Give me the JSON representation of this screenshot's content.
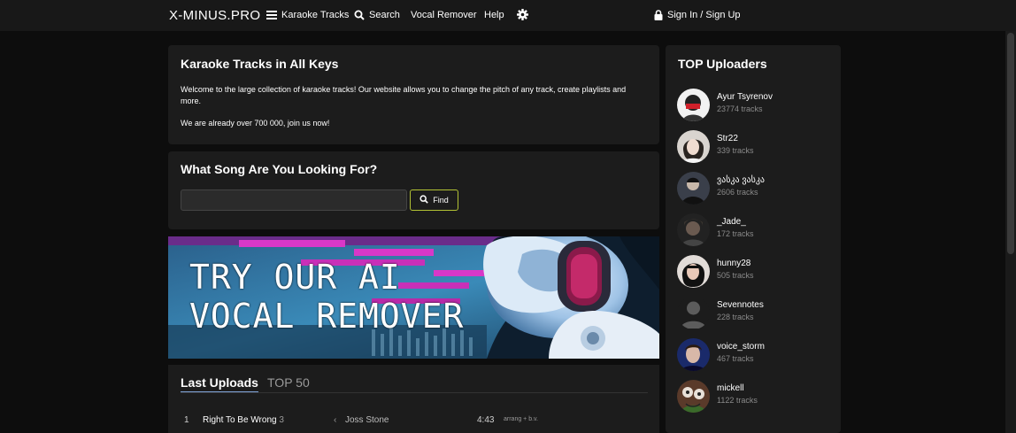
{
  "nav": {
    "logo": "X-MINUS.PRO",
    "karaoke_tracks": "Karaoke Tracks",
    "search": "Search",
    "vocal_remover": "Vocal Remover",
    "help": "Help",
    "sign_in": "Sign In / Sign Up"
  },
  "intro": {
    "title": "Karaoke Tracks in All Keys",
    "paragraph1": "Welcome to the large collection of karaoke tracks! Our website allows you to change the pitch of any track, create playlists and more.",
    "paragraph2": "We are already over 700 000, join us now!"
  },
  "search_box": {
    "title": "What Song Are You Looking For?",
    "input_value": "",
    "placeholder": "",
    "find_label": "Find"
  },
  "banner": {
    "line1": "TRY OUR AI",
    "line2": "VOCAL REMOVER"
  },
  "tabs": {
    "last_uploads": "Last Uploads",
    "top50": "TOP 50"
  },
  "uploads": [
    {
      "num": "1",
      "title": "Right To Be Wrong",
      "version": "3",
      "artist": "Joss Stone",
      "duration": "4:43",
      "tags": "arrang + b.v."
    }
  ],
  "sidebar": {
    "title": "TOP Uploaders",
    "uploaders": [
      {
        "name": "Ayur Tsyrenov",
        "tracks": "23774 tracks"
      },
      {
        "name": "Str22",
        "tracks": "339 tracks"
      },
      {
        "name": "ვასკა ვასკა",
        "tracks": "2606 tracks"
      },
      {
        "name": "_Jade_",
        "tracks": "172 tracks"
      },
      {
        "name": "hunny28",
        "tracks": "505 tracks"
      },
      {
        "name": "Sevennotes",
        "tracks": "228 tracks"
      },
      {
        "name": "voice_storm",
        "tracks": "467 tracks"
      },
      {
        "name": "mickell",
        "tracks": "1122 tracks"
      }
    ]
  },
  "colors": {
    "accent_border": "#b2c234",
    "tab_underline": "#7fa3d9",
    "panel_bg": "#1c1c1c",
    "topbar_bg": "#181818"
  }
}
